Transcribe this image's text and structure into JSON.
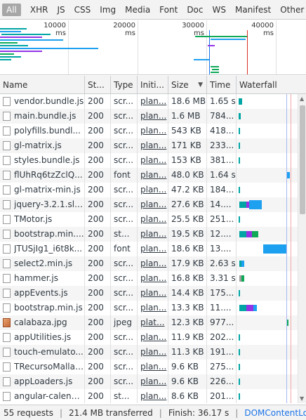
{
  "filters": [
    {
      "label": "All",
      "active": true
    },
    {
      "label": "XHR"
    },
    {
      "label": "JS"
    },
    {
      "label": "CSS"
    },
    {
      "label": "Img"
    },
    {
      "label": "Media"
    },
    {
      "label": "Font"
    },
    {
      "label": "Doc"
    },
    {
      "label": "WS"
    },
    {
      "label": "Manifest"
    },
    {
      "label": "Other"
    }
  ],
  "overview": {
    "ticks": [
      "10000 ms",
      "20000 ms",
      "30000 ms",
      "40000 ms"
    ]
  },
  "columns": {
    "name": "Name",
    "status": "St...",
    "type": "Type",
    "initiator": "Initi...",
    "size": "Size",
    "time": "Time",
    "waterfall": "Waterfall"
  },
  "rows": [
    {
      "name": "vendor.bundle.js",
      "status": "200",
      "type": "scr...",
      "initiator": "plan...",
      "size": "18.6 MB",
      "time": "1.65 s",
      "icon": "file-icon"
    },
    {
      "name": "main.bundle.js",
      "status": "200",
      "type": "scr...",
      "initiator": "plan...",
      "size": "1.6 MB",
      "time": "784...",
      "icon": "file-icon"
    },
    {
      "name": "polyfills.bundl...",
      "status": "200",
      "type": "scr...",
      "initiator": "plan...",
      "size": "543 KB",
      "time": "418...",
      "icon": "file-icon"
    },
    {
      "name": "gl-matrix.js",
      "status": "200",
      "type": "scr...",
      "initiator": "plan...",
      "size": "171 KB",
      "time": "233...",
      "icon": "file-icon"
    },
    {
      "name": "styles.bundle.js",
      "status": "200",
      "type": "scr...",
      "initiator": "plan...",
      "size": "153 KB",
      "time": "381...",
      "icon": "file-icon"
    },
    {
      "name": "flUhRq6tzZclQ...",
      "status": "200",
      "type": "font",
      "initiator": "plan...",
      "size": "48.0 KB",
      "time": "1.64 s",
      "icon": "file-icon"
    },
    {
      "name": "gl-matrix-min.js",
      "status": "200",
      "type": "scr...",
      "initiator": "plan...",
      "size": "47.2 KB",
      "time": "184...",
      "icon": "file-icon"
    },
    {
      "name": "jquery-3.2.1.sli...",
      "status": "200",
      "type": "scr...",
      "initiator": "plan...",
      "size": "27.6 KB",
      "time": "14....",
      "icon": "file-icon"
    },
    {
      "name": "TMotor.js",
      "status": "200",
      "type": "scr...",
      "initiator": "plan...",
      "size": "25.5 KB",
      "time": "251...",
      "icon": "file-icon"
    },
    {
      "name": "bootstrap.min....",
      "status": "200",
      "type": "st...",
      "initiator": "plan...",
      "size": "19.5 KB",
      "time": "12....",
      "icon": "file-icon"
    },
    {
      "name": "JTUSjIg1_i6t8k...",
      "status": "200",
      "type": "font",
      "initiator": "plan...",
      "size": "18.6 KB",
      "time": "13....",
      "icon": "file-icon"
    },
    {
      "name": "select2.min.js",
      "status": "200",
      "type": "scr...",
      "initiator": "plan...",
      "size": "17.9 KB",
      "time": "2.63 s",
      "icon": "file-icon"
    },
    {
      "name": "hammer.js",
      "status": "200",
      "type": "scr...",
      "initiator": "plan...",
      "size": "16.8 KB",
      "time": "3.31 s",
      "icon": "file-icon"
    },
    {
      "name": "appEvents.js",
      "status": "200",
      "type": "scr...",
      "initiator": "plan...",
      "size": "14.4 KB",
      "time": "175...",
      "icon": "file-icon"
    },
    {
      "name": "bootstrap.min.js",
      "status": "200",
      "type": "scr...",
      "initiator": "plan...",
      "size": "13.3 KB",
      "time": "11....",
      "icon": "file-icon"
    },
    {
      "name": "calabaza.jpg",
      "status": "200",
      "type": "jpeg",
      "initiator": "plat...",
      "size": "12.3 KB",
      "time": "977...",
      "icon": "image-file-icon"
    },
    {
      "name": "appUtilities.js",
      "status": "200",
      "type": "scr...",
      "initiator": "plan...",
      "size": "11.9 KB",
      "time": "202...",
      "icon": "file-icon"
    },
    {
      "name": "touch-emulato...",
      "status": "200",
      "type": "scr...",
      "initiator": "plan...",
      "size": "11.3 KB",
      "time": "191...",
      "icon": "file-icon"
    },
    {
      "name": "TRecursoMalla.js",
      "status": "200",
      "type": "scr...",
      "initiator": "plan...",
      "size": "9.6 KB",
      "time": "275...",
      "icon": "file-icon"
    },
    {
      "name": "appLoaders.js",
      "status": "200",
      "type": "scr...",
      "initiator": "plan...",
      "size": "9.6 KB",
      "time": "226...",
      "icon": "file-icon"
    },
    {
      "name": "angular-calend...",
      "status": "200",
      "type": "st...",
      "initiator": "plan...",
      "size": "8.6 KB",
      "time": "201...",
      "icon": "file-icon"
    }
  ],
  "status_bar": {
    "requests": "55 requests",
    "transferred": "21.4 MB transferred",
    "finish": "Finish: 36.17 s",
    "dcl": "DOMContentLoade..."
  },
  "colors": {
    "waiting": "#00a4a4",
    "download": "#1ea0f0",
    "stalled": "#9e9e9e",
    "script": "#9334e6",
    "green": "#0fa958",
    "dcl_line": "#1a73e8",
    "load_line": "#d93025"
  }
}
